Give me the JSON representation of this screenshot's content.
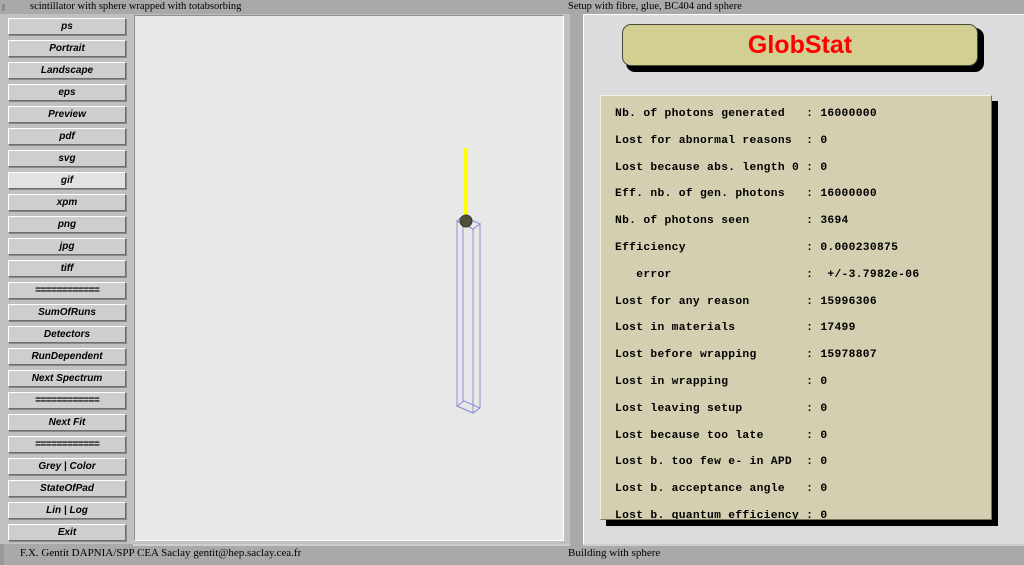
{
  "window": {
    "left_title": "scintillator with sphere wrapped with totabsorbing",
    "right_title": "Setup with fibre, glue, BC404 and sphere"
  },
  "statusbar": {
    "left": "F.X. Gentit  DAPNIA/SPP CEA Saclay  gentit@hep.saclay.cea.fr",
    "right": "Building with sphere"
  },
  "buttons": [
    {
      "label": "ps",
      "selected": false,
      "dots": false
    },
    {
      "label": "Portrait",
      "selected": false,
      "dots": false
    },
    {
      "label": "Landscape",
      "selected": false,
      "dots": false
    },
    {
      "label": "eps",
      "selected": false,
      "dots": false
    },
    {
      "label": "Preview",
      "selected": false,
      "dots": false
    },
    {
      "label": "pdf",
      "selected": false,
      "dots": false
    },
    {
      "label": "svg",
      "selected": false,
      "dots": false
    },
    {
      "label": "gif",
      "selected": true,
      "dots": false
    },
    {
      "label": "xpm",
      "selected": false,
      "dots": false
    },
    {
      "label": "png",
      "selected": false,
      "dots": false
    },
    {
      "label": "jpg",
      "selected": false,
      "dots": false
    },
    {
      "label": "tiff",
      "selected": false,
      "dots": false
    },
    {
      "label": "============",
      "selected": false,
      "dots": true
    },
    {
      "label": "SumOfRuns",
      "selected": false,
      "dots": false
    },
    {
      "label": "Detectors",
      "selected": false,
      "dots": false
    },
    {
      "label": "RunDependent",
      "selected": false,
      "dots": false
    },
    {
      "label": "Next Spectrum",
      "selected": false,
      "dots": false
    },
    {
      "label": "============",
      "selected": false,
      "dots": true
    },
    {
      "label": "Next Fit",
      "selected": false,
      "dots": false
    },
    {
      "label": "============",
      "selected": false,
      "dots": true
    },
    {
      "label": "Grey | Color",
      "selected": false,
      "dots": false
    },
    {
      "label": "StateOfPad",
      "selected": false,
      "dots": false
    },
    {
      "label": "Lin | Log",
      "selected": false,
      "dots": false
    },
    {
      "label": "Exit",
      "selected": false,
      "dots": false
    }
  ],
  "globstat": {
    "title": "GlobStat",
    "title_color": "#ff0000",
    "panel_color": "#d3cfb0",
    "header_color": "#d3cf92",
    "rows": [
      {
        "label": "Nb. of photons generated",
        "value": "16000000"
      },
      {
        "label": "Lost for abnormal reasons",
        "value": "0"
      },
      {
        "label": "Lost because abs. length 0",
        "value": "0"
      },
      {
        "label": "Eff. nb. of gen. photons",
        "value": "16000000"
      },
      {
        "label": "Nb. of photons seen",
        "value": "3694"
      },
      {
        "label": "Efficiency",
        "value": "0.000230875"
      },
      {
        "label": "   error",
        "value": " +/-3.7982e-06"
      },
      {
        "label": "Lost for any reason",
        "value": "15996306"
      },
      {
        "label": "Lost in materials",
        "value": "17499"
      },
      {
        "label": "Lost before wrapping",
        "value": "15978807"
      },
      {
        "label": "Lost in wrapping",
        "value": "0"
      },
      {
        "label": "Lost leaving setup",
        "value": "0"
      },
      {
        "label": "Lost because too late",
        "value": "0"
      },
      {
        "label": "Lost b. too few e- in APD",
        "value": "0"
      },
      {
        "label": "Lost b. acceptance angle",
        "value": "0"
      },
      {
        "label": "Lost b. quantum efficiency",
        "value": "0"
      }
    ]
  },
  "scene": {
    "wire_color": "#8f8fd8",
    "fibre_color": "#ffff00",
    "sphere_color": "#4f4f3c",
    "background": "#e8e8e8"
  }
}
